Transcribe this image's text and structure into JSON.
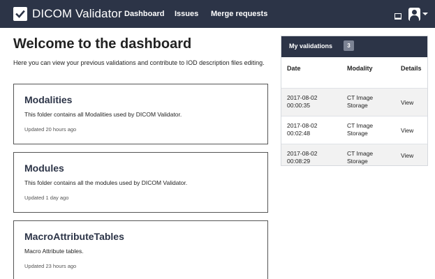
{
  "navbar": {
    "brand": "DICOM Validator",
    "links": [
      "Dashboard",
      "Issues",
      "Merge requests"
    ]
  },
  "main": {
    "title": "Welcome to the dashboard",
    "intro": "Here you can view your previous validations and contribute to IOD description files editing.",
    "cards": [
      {
        "title": "Modalities",
        "description": "This folder contains all Modalities used by DICOM Validator.",
        "updated": "Updated 20 hours ago"
      },
      {
        "title": "Modules",
        "description": "This folder contains all the modules used by DICOM Validator.",
        "updated": "Updated 1 day ago"
      },
      {
        "title": "MacroAttributeTables",
        "description": "Macro Attribute tables.",
        "updated": "Updated 23 hours ago"
      }
    ]
  },
  "validations": {
    "title": "My validations",
    "count": "3",
    "columns": [
      "Date",
      "Modality",
      "Details"
    ],
    "rows": [
      {
        "date": "2017-08-02\n00:00:35",
        "modality": "CT Image\nStorage",
        "details": "View"
      },
      {
        "date": "2017-08-02\n00:02:48",
        "modality": "CT Image\nStorage",
        "details": "View"
      },
      {
        "date": "2017-08-02\n00:08:29",
        "modality": "CT Image\nStorage",
        "details": "View"
      }
    ]
  },
  "icons": [
    "check-square-icon",
    "document-icon",
    "user-icon",
    "caret-down-icon"
  ],
  "colors": {
    "navbar": "#2c3447",
    "badge": "#7c8394",
    "row_alt": "#f2f2f2"
  }
}
